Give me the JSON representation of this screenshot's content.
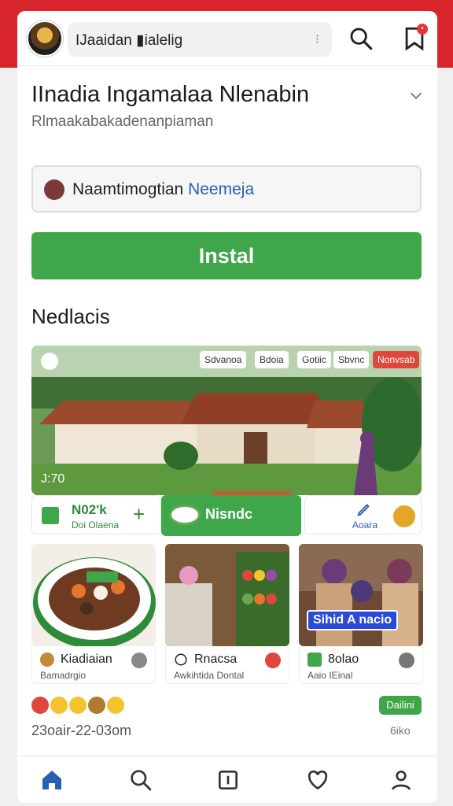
{
  "top_bar": {
    "search_text": "IJaaidan ▮ialelig",
    "notification_count": "•"
  },
  "app": {
    "title": "IInadia Ingamalaa Nlenabin",
    "subtitle": "Rlmaakabakadenanpiaman"
  },
  "install_section": {
    "field_text": "Naamtimogtian",
    "field_text_accent": "Neemeja",
    "install_label": "Instal"
  },
  "section_title": "Nedlacis",
  "hero": {
    "chips": [
      "Sdvanoa",
      "Bdoia",
      "Gotiic",
      "Sbvnc",
      "Nonvsab"
    ],
    "counter": "J:70"
  },
  "actions": {
    "first_label": "N02'k",
    "first_sub": "Doi Olaena",
    "middle_label": "Nisndc",
    "last_label": "Aoara"
  },
  "cards": [
    {
      "name": "Kiadiaian",
      "sub": "Bamadrgio"
    },
    {
      "name": "Rnacsa",
      "sub": "Awkihtida Dontal"
    },
    {
      "name": "8olao",
      "sub": "Aaio IEinal",
      "badge": "Sihid A nacio"
    }
  ],
  "footer": {
    "date": "23oair-22-03om",
    "count": "6iko",
    "pill": "Dailini"
  },
  "colors": {
    "brand_red": "#d8242b",
    "install_green": "#3fa64a",
    "accent_blue": "#2a5fb0"
  },
  "icons": [
    "search-icon",
    "bookmark-icon",
    "chevron-down-icon",
    "home-icon",
    "plus-square-icon",
    "heart-icon",
    "profile-icon"
  ]
}
